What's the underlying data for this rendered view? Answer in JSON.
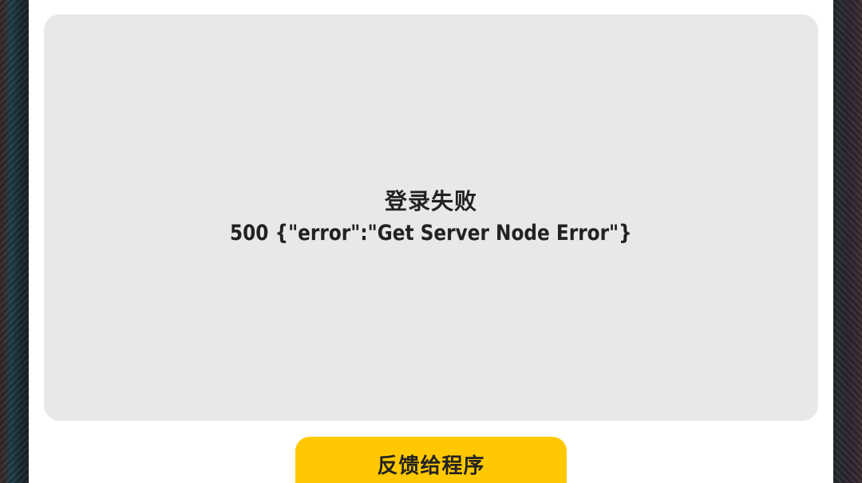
{
  "dialog": {
    "message_title": "登录失败",
    "message_detail": "500 {\"error\":\"Get Server Node Error\"}",
    "feedback_button_label": "反馈给程序"
  },
  "colors": {
    "dialog_background": "#ffffff",
    "panel_background": "#e8e8e8",
    "button_background": "#ffc800",
    "text": "#222222"
  }
}
